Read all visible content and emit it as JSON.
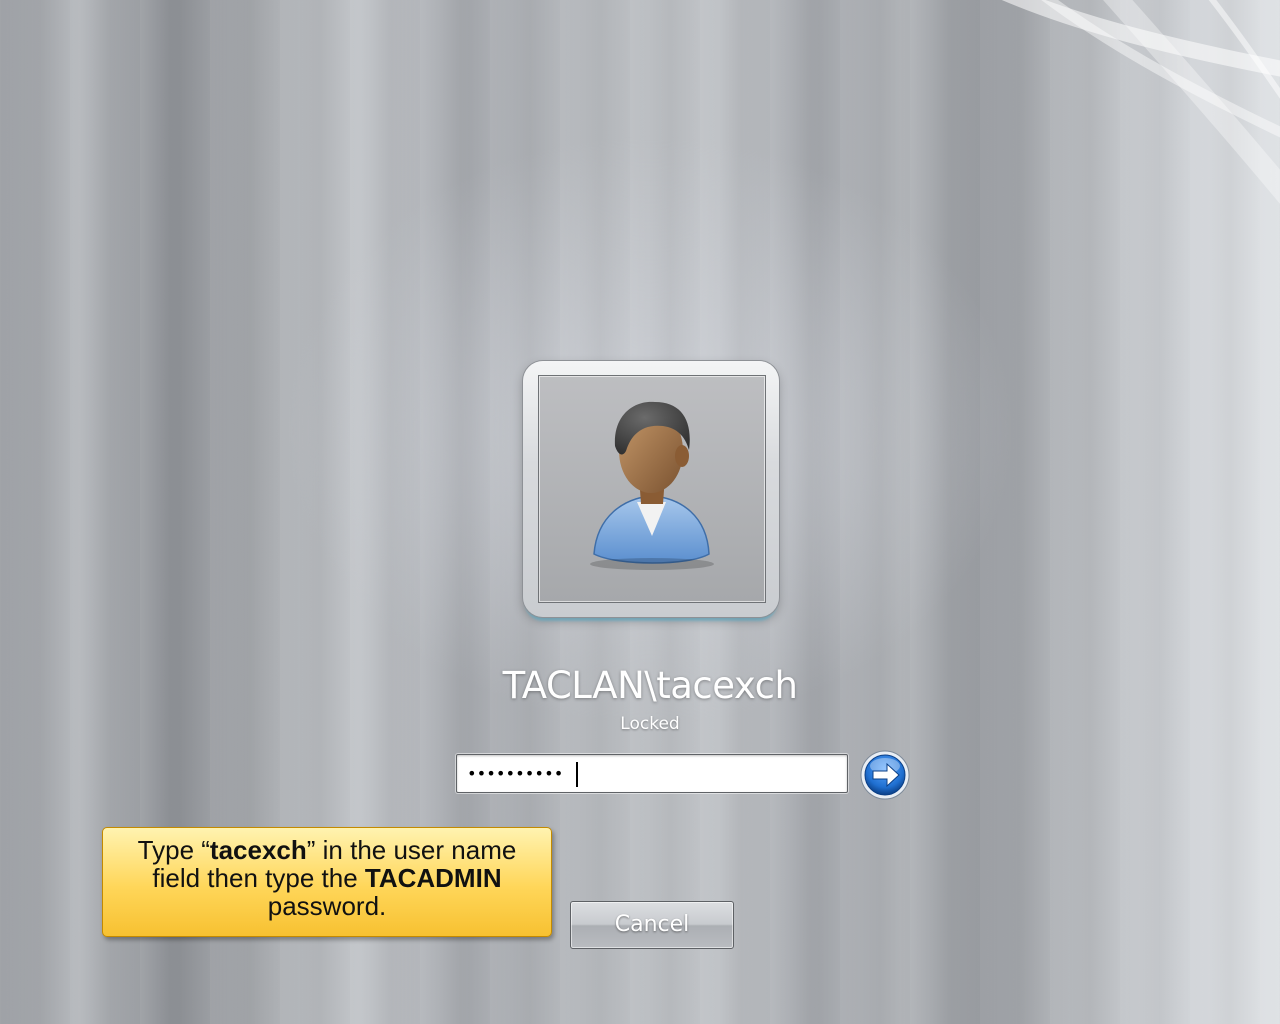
{
  "account": {
    "name": "TACLAN\\tacexch",
    "status": "Locked"
  },
  "password_field": {
    "masked_value": "••••••••••"
  },
  "buttons": {
    "cancel_label": "Cancel"
  },
  "callout": {
    "line1_a": "Type “",
    "line1_b": "tacexch",
    "line1_c": "” in the user name",
    "line2_a": "field then type the ",
    "line2_b": "TACADMIN",
    "line3": "password."
  },
  "icons": {
    "avatar": "user-avatar-icon",
    "submit": "arrow-right-circle-icon"
  },
  "colors": {
    "callout_fill": "#ffd659",
    "go_button": "#1f6fd0",
    "tile_glow": "#6ec8e6"
  }
}
